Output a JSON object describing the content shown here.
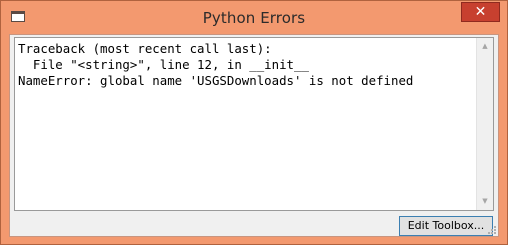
{
  "window": {
    "title": "Python Errors",
    "close_glyph": "✕",
    "icon": "app-window-icon"
  },
  "output": {
    "lines": [
      "Traceback (most recent call last):",
      "  File \"<string>\", line 12, in __init__",
      "NameError: global name 'USGSDownloads' is not defined"
    ]
  },
  "scrollbar": {
    "up_glyph": "▲",
    "down_glyph": "▼"
  },
  "buttons": {
    "edit_toolbox": "Edit Toolbox..."
  },
  "colors": {
    "frame": "#f3996f",
    "close_button": "#c7402f",
    "button_border": "#3c7fb1"
  }
}
